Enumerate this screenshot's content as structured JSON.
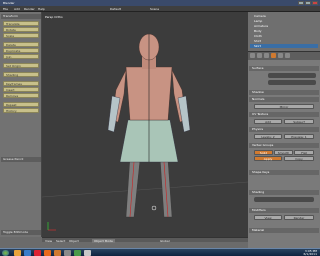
{
  "window": {
    "title": "Blender"
  },
  "menubar": {
    "items": [
      "File",
      "Add",
      "Render",
      "Help"
    ],
    "layout": "Default",
    "scene": "Scene"
  },
  "toolshelf": {
    "transform_header": "Transform",
    "buttons": [
      "Translate",
      "Rotate",
      "Scale",
      "Delete",
      "Duplicate",
      "Join",
      "Set Origin",
      "Shading",
      "Keyframes",
      "Insert",
      "Remove",
      "Repeat",
      "History"
    ],
    "grease_header": "Grease Pencil",
    "toggle_label": "Toggle Editmode"
  },
  "viewport": {
    "label": "Persp Ortho",
    "footer": {
      "view": "View",
      "select": "Select",
      "object": "Object",
      "mode": "Object Mode",
      "global": "Global"
    }
  },
  "outliner": {
    "rows": [
      "Camera",
      "Lamp",
      "Armature",
      "Body",
      "Cloth",
      "Shirt",
      "Skirt"
    ],
    "selected": "Skirt"
  },
  "properties": {
    "sections": [
      "Surface",
      "Shadow",
      "Normals",
      "UV Texture",
      "Physics",
      "Vertex Groups",
      "Shape Keys",
      "Shading",
      "Modifiers",
      "Material"
    ],
    "buttons": {
      "mirror": "Mirror",
      "add": "Add",
      "subsurf": "Subsurf",
      "solid": "Solid",
      "smooth": "Smooth",
      "flat": "Flat",
      "apply": "Apply",
      "copy": "Copy",
      "view": "View",
      "render": "Render",
      "levels": "Levels: 2",
      "preview": "Preview: 1"
    }
  },
  "taskbar": {
    "time": "3:05 PM",
    "date": "6/1/2011"
  },
  "colors": {
    "accent": "#d07a30",
    "shelf_button": "#c8c08a",
    "selected_row": "#3a6ea5"
  }
}
